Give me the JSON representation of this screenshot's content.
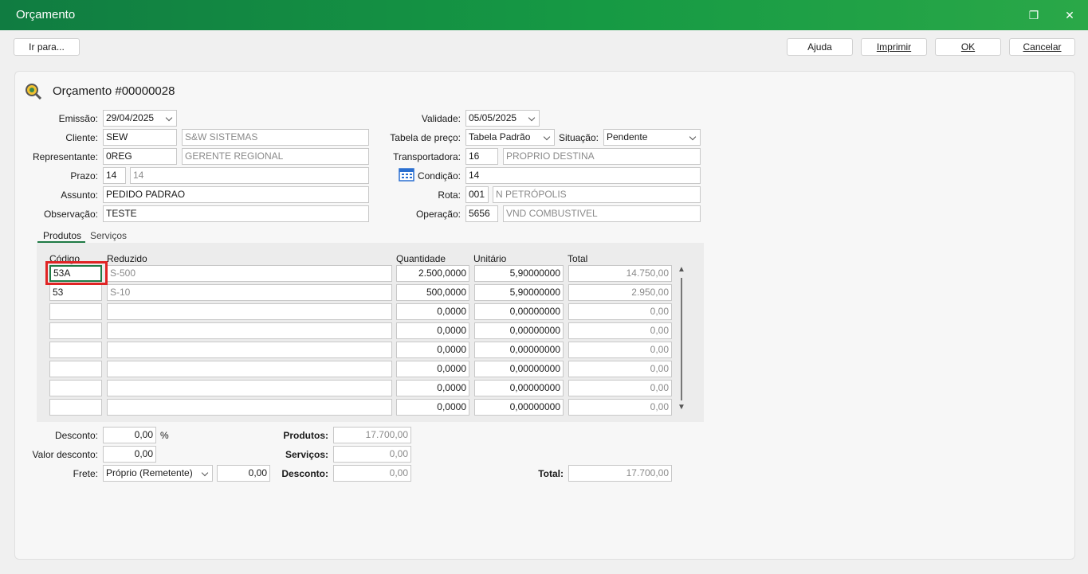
{
  "window": {
    "title": "Orçamento",
    "restore_icon": "❐",
    "close_icon": "✕"
  },
  "toolbar": {
    "goto": "Ir para...",
    "help": "Ajuda",
    "print": "Imprimir",
    "ok": "OK",
    "cancel": "Cancelar"
  },
  "header": {
    "title": "Orçamento #00000028",
    "icon": "magnifier-icon"
  },
  "form": {
    "emissao_label": "Emissão:",
    "emissao": "29/04/2025",
    "cliente_label": "Cliente:",
    "cliente_code": "SEW",
    "cliente_name": "S&W SISTEMAS",
    "representante_label": "Representante:",
    "representante_code": "0REG",
    "representante_name": "GERENTE REGIONAL",
    "prazo_label": "Prazo:",
    "prazo": "14",
    "prazo_desc": "14",
    "assunto_label": "Assunto:",
    "assunto": "PEDIDO PADRAO",
    "observacao_label": "Observação:",
    "observacao": "TESTE",
    "validade_label": "Validade:",
    "validade": "05/05/2025",
    "tabela_label": "Tabela de preço:",
    "tabela": "Tabela Padrão",
    "situacao_label": "Situação:",
    "situacao": "Pendente",
    "transportadora_label": "Transportadora:",
    "transportadora_code": "16",
    "transportadora_name": "PROPRIO DESTINA",
    "condicao_label": "Condição:",
    "condicao": "14",
    "rota_label": "Rota:",
    "rota_code": "001",
    "rota_name": "N PETRÓPOLIS",
    "operacao_label": "Operação:",
    "operacao_code": "5656",
    "operacao_name": "VND COMBUSTIVEL"
  },
  "tabs": {
    "produtos": "Produtos",
    "servicos": "Serviços"
  },
  "grid": {
    "headers": {
      "codigo": "Código",
      "reduzido": "Reduzido",
      "quantidade": "Quantidade",
      "unitario": "Unitário",
      "total": "Total"
    },
    "rows": [
      {
        "codigo": "53A",
        "reduzido": "S-500",
        "quantidade": "2.500,0000",
        "unitario": "5,90000000",
        "total": "14.750,00"
      },
      {
        "codigo": "53",
        "reduzido": "S-10",
        "quantidade": "500,0000",
        "unitario": "5,90000000",
        "total": "2.950,00"
      },
      {
        "codigo": "",
        "reduzido": "",
        "quantidade": "0,0000",
        "unitario": "0,00000000",
        "total": "0,00"
      },
      {
        "codigo": "",
        "reduzido": "",
        "quantidade": "0,0000",
        "unitario": "0,00000000",
        "total": "0,00"
      },
      {
        "codigo": "",
        "reduzido": "",
        "quantidade": "0,0000",
        "unitario": "0,00000000",
        "total": "0,00"
      },
      {
        "codigo": "",
        "reduzido": "",
        "quantidade": "0,0000",
        "unitario": "0,00000000",
        "total": "0,00"
      },
      {
        "codigo": "",
        "reduzido": "",
        "quantidade": "0,0000",
        "unitario": "0,00000000",
        "total": "0,00"
      },
      {
        "codigo": "",
        "reduzido": "",
        "quantidade": "0,0000",
        "unitario": "0,00000000",
        "total": "0,00"
      }
    ]
  },
  "totals": {
    "desconto_label": "Desconto:",
    "desconto": "0,00",
    "percent": "%",
    "valor_desconto_label": "Valor desconto:",
    "valor_desconto": "0,00",
    "frete_label": "Frete:",
    "frete": "Próprio (Remetente)",
    "frete_value": "0,00",
    "produtos_label": "Produtos:",
    "produtos": "17.700,00",
    "servicos_label": "Serviços:",
    "servicos": "0,00",
    "desconto2_label": "Desconto:",
    "desconto2": "0,00",
    "total_label": "Total:",
    "total": "17.700,00"
  },
  "colors": {
    "title_bar": "#107c41",
    "highlight": "#e02424",
    "accent": "#1f7a45"
  }
}
